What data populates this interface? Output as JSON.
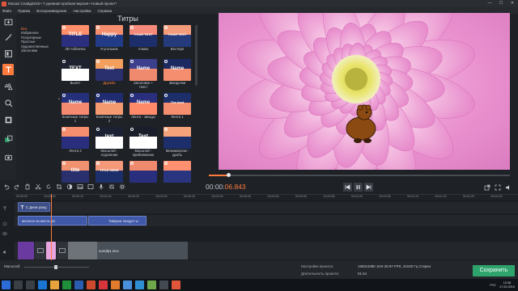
{
  "window": {
    "title": "Movavi Слайд2019 • 7-дневная пробная версия • Новый проект*",
    "controls": [
      "—",
      "☐",
      "✕"
    ]
  },
  "menu": [
    "Файл",
    "Правка",
    "Воспроизведение",
    "Настройки",
    "Справка"
  ],
  "tools": [
    {
      "name": "import",
      "icon": "import-icon"
    },
    {
      "name": "magic-wand",
      "icon": "magic-wand-icon"
    },
    {
      "name": "filters",
      "icon": "filters-icon"
    },
    {
      "name": "titles",
      "icon": "titles-icon",
      "active": true
    },
    {
      "name": "stickers",
      "icon": "stickers-icon"
    },
    {
      "name": "zoom",
      "icon": "zoom-icon"
    },
    {
      "name": "callouts",
      "icon": "callouts-icon"
    },
    {
      "name": "transitions",
      "icon": "transitions-icon"
    },
    {
      "name": "record",
      "icon": "record-icon"
    }
  ],
  "categories": [
    {
      "label": "Все",
      "selected": true
    },
    {
      "label": "Избранное"
    },
    {
      "label": "Популярные"
    },
    {
      "label": "Простые"
    },
    {
      "label": "Художественные"
    },
    {
      "label": "Заголовки"
    }
  ],
  "panel": {
    "title": "Титры",
    "tiles": [
      {
        "label": "3D-табличка",
        "thumb": "TITLE"
      },
      {
        "label": "8-угольник",
        "thumb": "Happy"
      },
      {
        "label": "Алмаз",
        "thumb": "YOUR TEXT"
      },
      {
        "label": "Вестерн",
        "thumb": "YOUR TEXT"
      },
      {
        "label": "Вылет",
        "thumb": "TEXT"
      },
      {
        "label": "Дружба",
        "thumb": "Text",
        "highlight": true
      },
      {
        "label": "Заголовок + текст",
        "thumb": "Name"
      },
      {
        "label": "Звездочки",
        "thumb": "Name"
      },
      {
        "label": "Конечные титры 1",
        "thumb": "Name"
      },
      {
        "label": "Конечные титры 2",
        "thumb": "Name"
      },
      {
        "label": "Лента - звезды",
        "thumb": "Name"
      },
      {
        "label": "Лента 1",
        "thumb": "The best"
      },
      {
        "label": "Лента 2",
        "thumb": ""
      },
      {
        "label": "Масштаб - отдаление",
        "thumb": "text"
      },
      {
        "label": "Масштаб - приближение",
        "thumb": "Text"
      },
      {
        "label": "Минимализм - дробь",
        "thumb": ""
      },
      {
        "label": "",
        "thumb": "title"
      },
      {
        "label": "",
        "thumb": "TITLE HERE"
      },
      {
        "label": "",
        "thumb": ""
      },
      {
        "label": "",
        "thumb": ""
      }
    ]
  },
  "player": {
    "time_dim": "00:00:",
    "time_bright": "06.843",
    "progress": 0.06
  },
  "ruler": [
    "00:00:00",
    "00:00:05",
    "00:00:10",
    "00:00:15",
    "00:00:20",
    "00:00:25",
    "00:00:30",
    "00:00:35",
    "00:00:40",
    "00:00:45",
    "00:00:50",
    "00:00:55",
    "00:01:00",
    "00:01:05",
    "00:01:10",
    "00:01:15",
    "00:01:20",
    "00:01:25"
  ],
  "timeline": {
    "title_clip": "С Днем рожд",
    "text_clip1": "веселое на места.avi",
    "text_clip2": "Таверна танцует ы",
    "video_clip": "ouncilp1.mov"
  },
  "bottom": {
    "zoom_label": "Масштаб:",
    "settings_label": "Настройки проекта:",
    "settings_value": "1920x1080 16:9 29.97 FPS, 44100 Гц Стерео",
    "duration_label": "Длительность проекта:",
    "duration_value": "01:44",
    "save_button": "Сохранить"
  },
  "taskbar": {
    "lang": "РУС",
    "time": "12:08",
    "date": "17.02.2019"
  },
  "colors": {
    "accent": "#ff7a3d",
    "save": "#2ea36b",
    "bg": "#1e2227"
  }
}
